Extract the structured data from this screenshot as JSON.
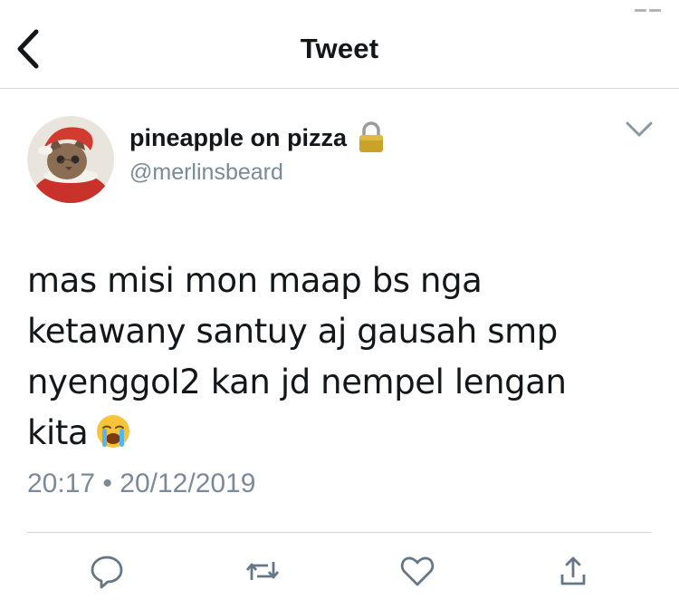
{
  "header": {
    "title": "Tweet",
    "back_icon": "chevron-left-icon"
  },
  "tweet": {
    "author": {
      "display_name": "pineapple on pizza",
      "handle": "@merlinsbeard",
      "protected_icon": "lock-icon",
      "avatar": "cat-in-santa-costume"
    },
    "text_lines": [
      "mas misi mon maap bs nga",
      "ketawany santuy aj gausah smp",
      "nyenggol2 kan jd nempel lengan",
      "kita"
    ],
    "emoji": "loudly-crying-face",
    "time": "20:17",
    "separator": "•",
    "date": "20/12/2019"
  },
  "actions": [
    {
      "name": "reply",
      "icon": "reply-bubble-icon"
    },
    {
      "name": "retweet",
      "icon": "retweet-icon"
    },
    {
      "name": "like",
      "icon": "heart-icon"
    },
    {
      "name": "share",
      "icon": "share-icon"
    }
  ],
  "colors": {
    "text": "#14171a",
    "secondary": "#7b8a99",
    "icon": "#657786",
    "divider": "#d9d9d9",
    "lock_gold": "#c9a227",
    "avatar_red": "#c8322a"
  }
}
